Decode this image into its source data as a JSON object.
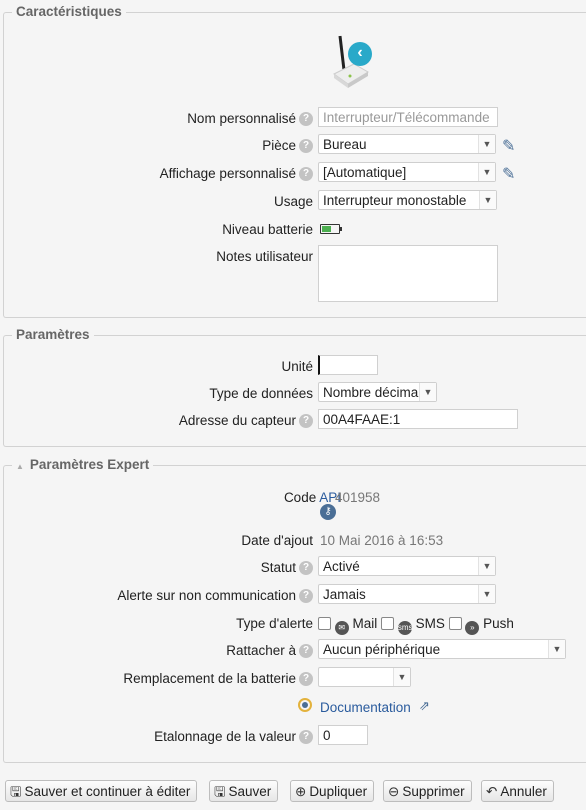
{
  "sections": {
    "characteristics": "Caractéristiques",
    "parameters": "Paramètres",
    "expert": "Paramètres Expert"
  },
  "characteristics": {
    "name_label": "Nom personnalisé",
    "name_placeholder": "Interrupteur/Télécommande",
    "room_label": "Pièce",
    "room_value": "Bureau",
    "display_label": "Affichage personnalisé",
    "display_value": "[Automatique]",
    "usage_label": "Usage",
    "usage_value": "Interrupteur monostable",
    "battery_label": "Niveau batterie",
    "notes_label": "Notes utilisateur",
    "notes_value": ""
  },
  "parameters": {
    "unit_label": "Unité",
    "unit_value": "",
    "datatype_label": "Type de données",
    "datatype_value": "Nombre décima",
    "address_label": "Adresse du capteur",
    "address_value": "00A4FAAE:1"
  },
  "expert": {
    "code_label": "Code",
    "code_api": "API",
    "code_value": "401958",
    "date_label": "Date d'ajout",
    "date_value": "10 Mai 2016 à 16:53",
    "status_label": "Statut",
    "status_value": "Activé",
    "alert_label": "Alerte sur non communication",
    "alert_value": "Jamais",
    "alerttype_label": "Type d'alerte",
    "alert_mail": "Mail",
    "alert_sms": "SMS",
    "alert_push": "Push",
    "attach_label": "Rattacher à",
    "attach_value": "Aucun périphérique",
    "battery_replace_label": "Remplacement de la batterie",
    "battery_replace_value": "",
    "doc_link": "Documentation",
    "calibration_label": "Etalonnage de la valeur",
    "calibration_value": "0"
  },
  "buttons": {
    "save_continue": "Sauver et continuer à éditer",
    "save": "Sauver",
    "duplicate": "Dupliquer",
    "delete": "Supprimer",
    "cancel": "Annuler"
  },
  "colors": {
    "accent": "#2a5b9d",
    "battery": "#4caf50",
    "device_badge": "#29a9c9"
  }
}
